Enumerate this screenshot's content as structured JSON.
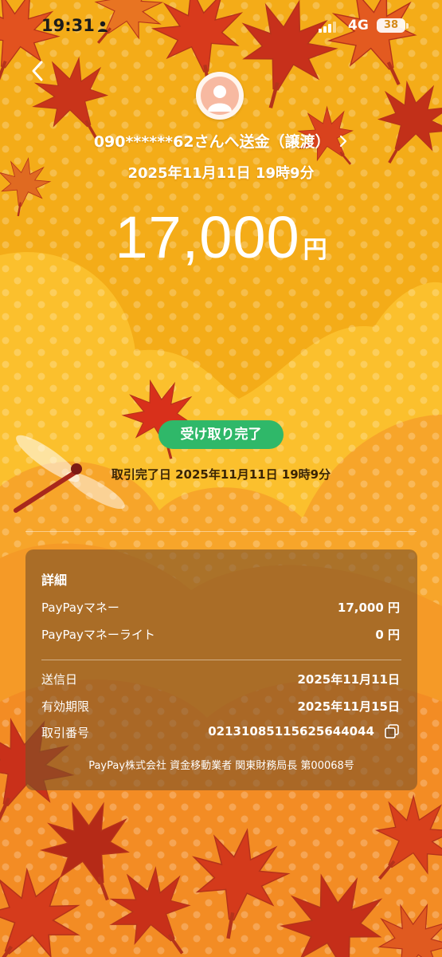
{
  "status_bar": {
    "time": "19:31",
    "network": "4G",
    "battery": "38"
  },
  "header": {
    "recipient_link": "090******62さんへ送金（譲渡）",
    "sent_datetime": "2025年11月11日 19時9分"
  },
  "amount": {
    "value": "17,000",
    "unit": "円"
  },
  "status": {
    "badge": "受け取り完了",
    "completed_datetime": "取引完了日 2025年11月11日 19時9分"
  },
  "details": {
    "title": "詳細",
    "money_label": "PayPayマネー",
    "money_value": "17,000 円",
    "money_lite_label": "PayPayマネーライト",
    "money_lite_value": "0 円",
    "sent_date_label": "送信日",
    "sent_date_value": "2025年11月11日",
    "expiry_label": "有効期限",
    "expiry_value": "2025年11月15日",
    "transaction_label": "取引番号",
    "transaction_value": "02131085115625644044",
    "footer": "PayPay株式会社 資金移動業者 関東財務局長 第00068号"
  },
  "theme": {
    "accent_green": "#2fb869",
    "background_orange": "#f4b01c",
    "leaf_red": "#d9341c"
  },
  "icons": [
    "person-icon",
    "signal-icon",
    "battery-icon",
    "back-chevron-icon",
    "avatar-icon",
    "chevron-right-icon",
    "copy-icon"
  ]
}
